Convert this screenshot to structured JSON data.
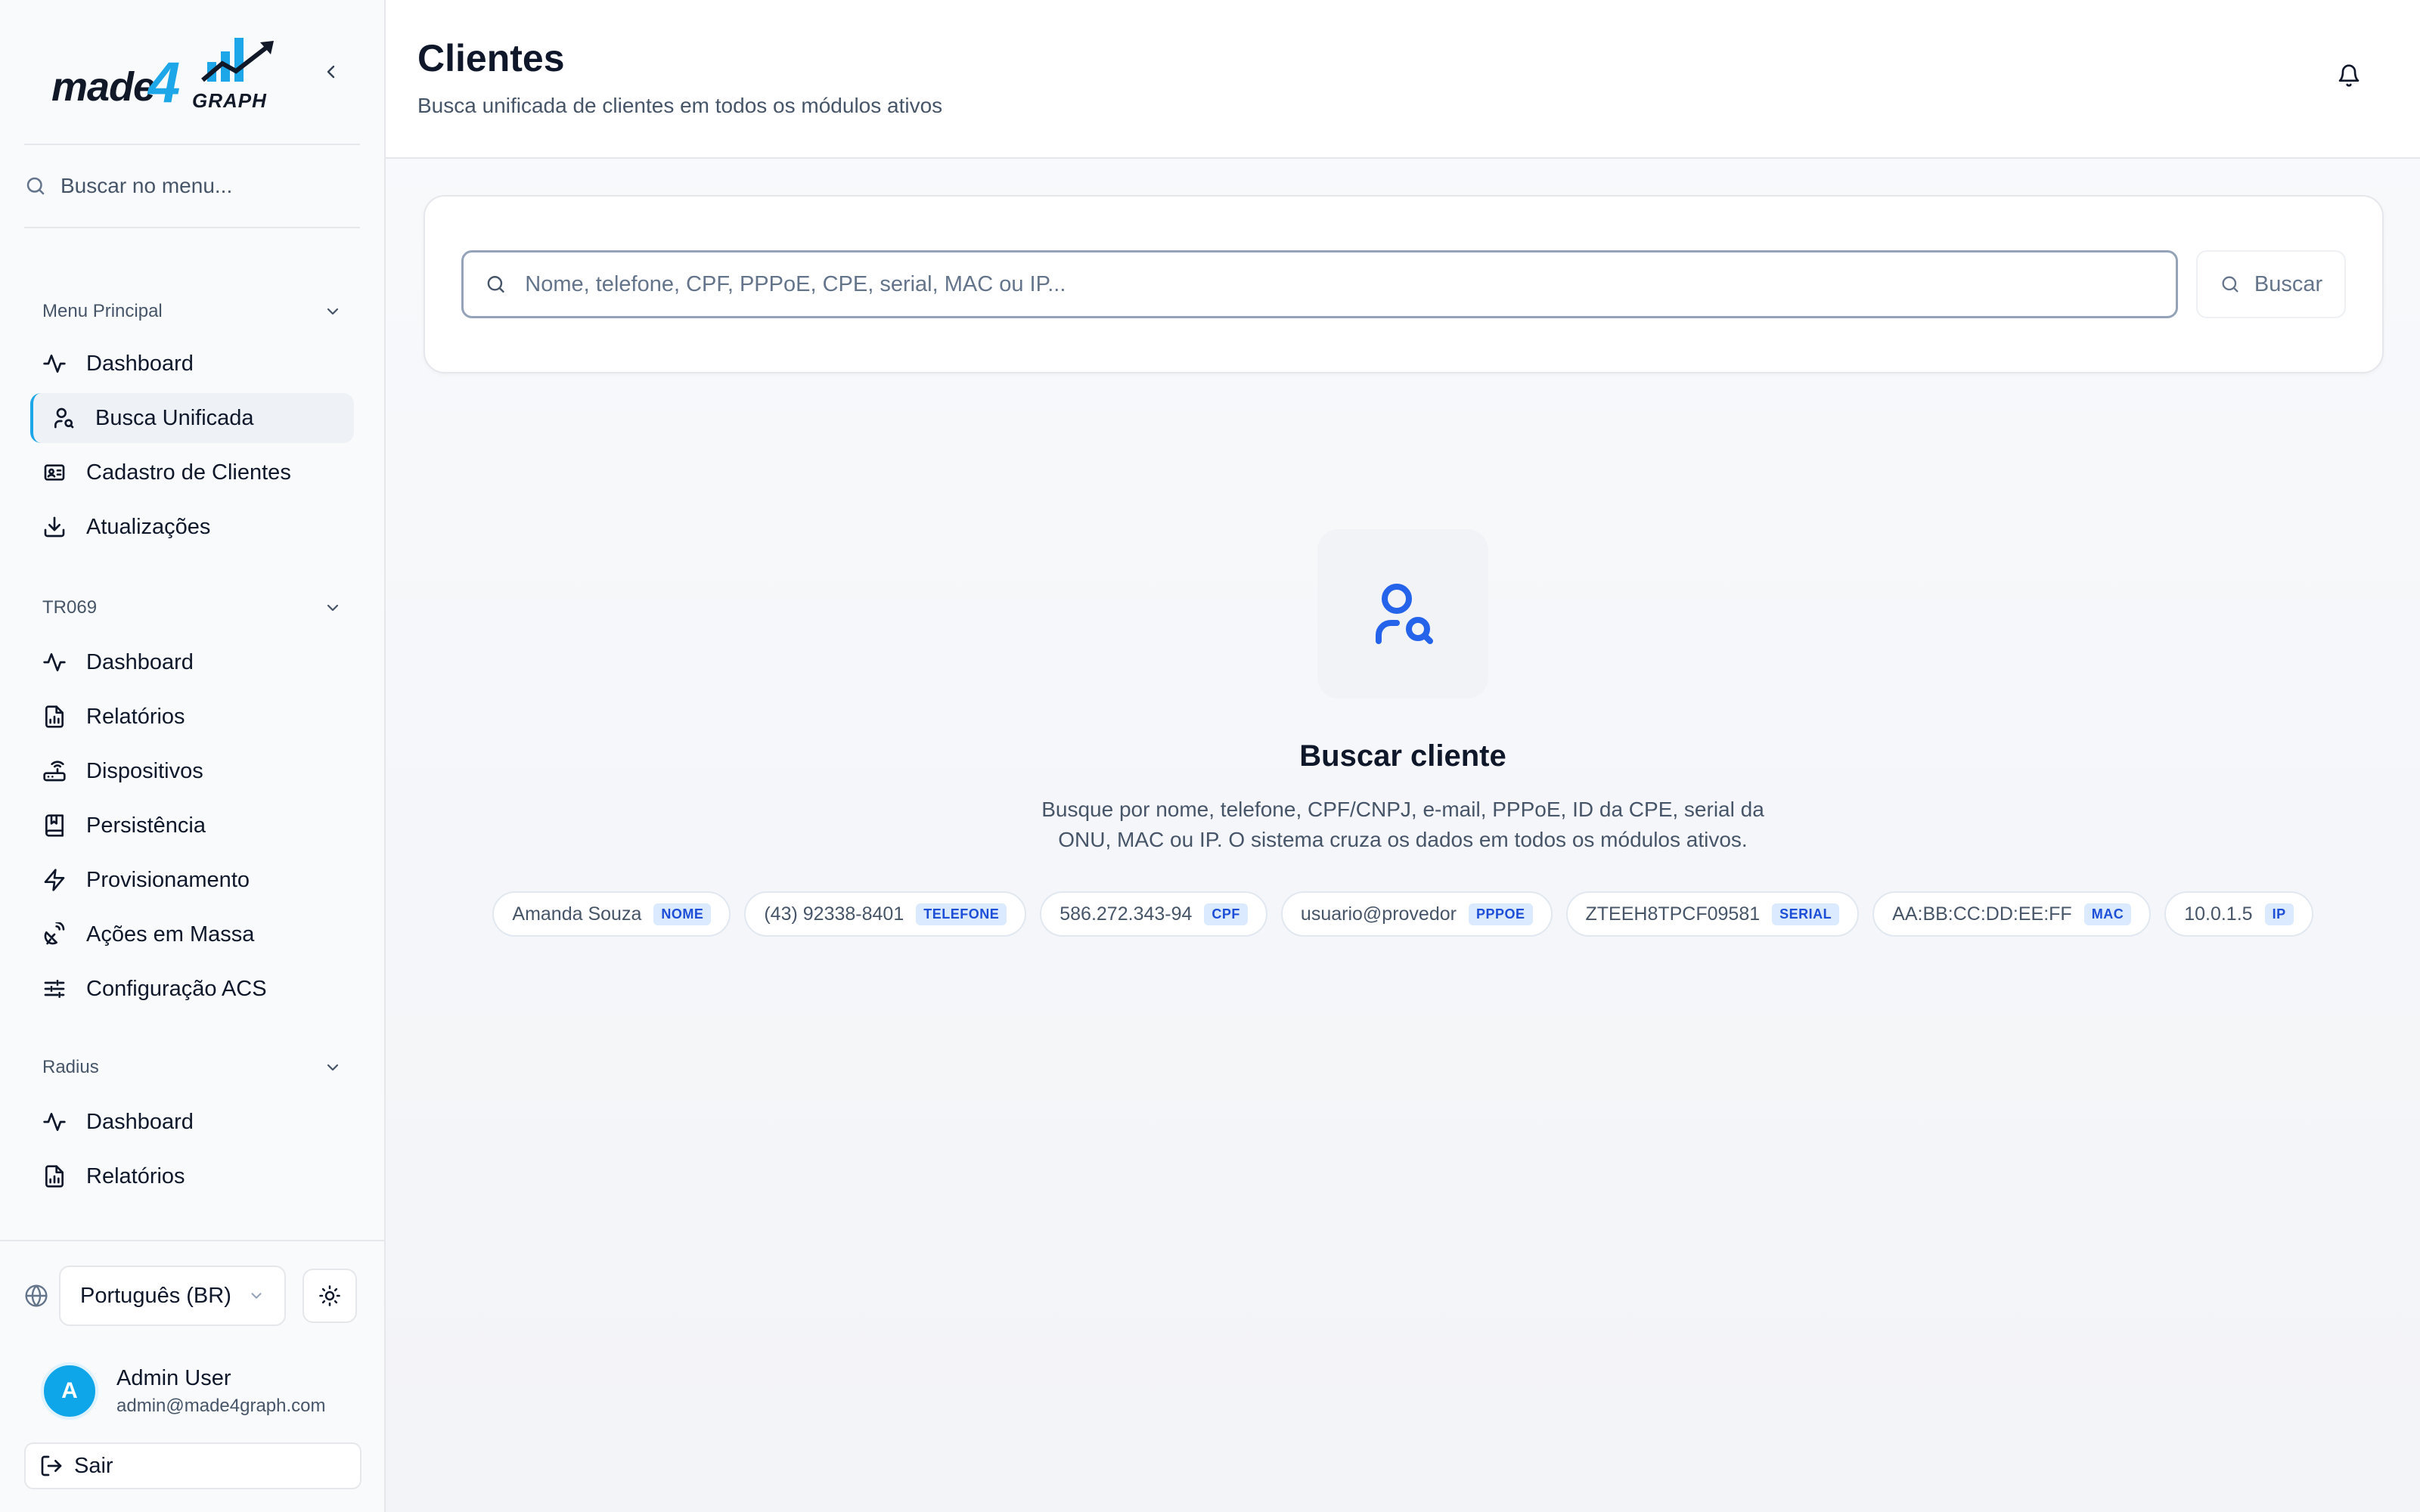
{
  "brand": {
    "logo_made": "made",
    "logo_four": "4",
    "logo_graph": "GRAPH"
  },
  "sidebar": {
    "search_placeholder": "Buscar no menu...",
    "groups": [
      {
        "title": "Menu Principal",
        "items": [
          {
            "label": "Dashboard",
            "icon": "activity-icon"
          },
          {
            "label": "Busca Unificada",
            "icon": "user-search-icon",
            "active": true
          },
          {
            "label": "Cadastro de Clientes",
            "icon": "id-card-icon"
          },
          {
            "label": "Atualizações",
            "icon": "download-icon"
          }
        ]
      },
      {
        "title": "TR069",
        "items": [
          {
            "label": "Dashboard",
            "icon": "activity-icon"
          },
          {
            "label": "Relatórios",
            "icon": "file-chart-icon"
          },
          {
            "label": "Dispositivos",
            "icon": "router-icon"
          },
          {
            "label": "Persistência",
            "icon": "bookmark-book-icon"
          },
          {
            "label": "Provisionamento",
            "icon": "zap-icon"
          },
          {
            "label": "Ações em Massa",
            "icon": "satellite-dish-icon"
          },
          {
            "label": "Configuração ACS",
            "icon": "sliders-icon"
          }
        ]
      },
      {
        "title": "Radius",
        "items": [
          {
            "label": "Dashboard",
            "icon": "activity-icon"
          },
          {
            "label": "Relatórios",
            "icon": "file-chart-icon"
          }
        ]
      }
    ],
    "language": "Português (BR)",
    "user": {
      "initial": "A",
      "name": "Admin User",
      "email": "admin@made4graph.com"
    },
    "logout_label": "Sair"
  },
  "header": {
    "title": "Clientes",
    "subtitle": "Busca unificada de clientes em todos os módulos ativos"
  },
  "search": {
    "placeholder": "Nome, telefone, CPF, PPPoE, CPE, serial, MAC ou IP...",
    "button_label": "Buscar"
  },
  "empty_state": {
    "title": "Buscar cliente",
    "description": "Busque por nome, telefone, CPF/CNPJ, e-mail, PPPoE, ID da CPE, serial da ONU, MAC ou IP. O sistema cruza os dados em todos os módulos ativos.",
    "examples": [
      {
        "value": "Amanda Souza",
        "tag": "NOME"
      },
      {
        "value": "(43) 92338-8401",
        "tag": "TELEFONE"
      },
      {
        "value": "586.272.343-94",
        "tag": "CPF"
      },
      {
        "value": "usuario@provedor",
        "tag": "PPPOE"
      },
      {
        "value": "ZTEEH8TPCF09581",
        "tag": "SERIAL"
      },
      {
        "value": "AA:BB:CC:DD:EE:FF",
        "tag": "MAC"
      },
      {
        "value": "10.0.1.5",
        "tag": "IP"
      }
    ]
  },
  "colors": {
    "accent": "#1ea7e8",
    "icon_blue": "#2563eb",
    "tag_bg": "#dbeafe",
    "tag_text": "#1d4ed8"
  }
}
